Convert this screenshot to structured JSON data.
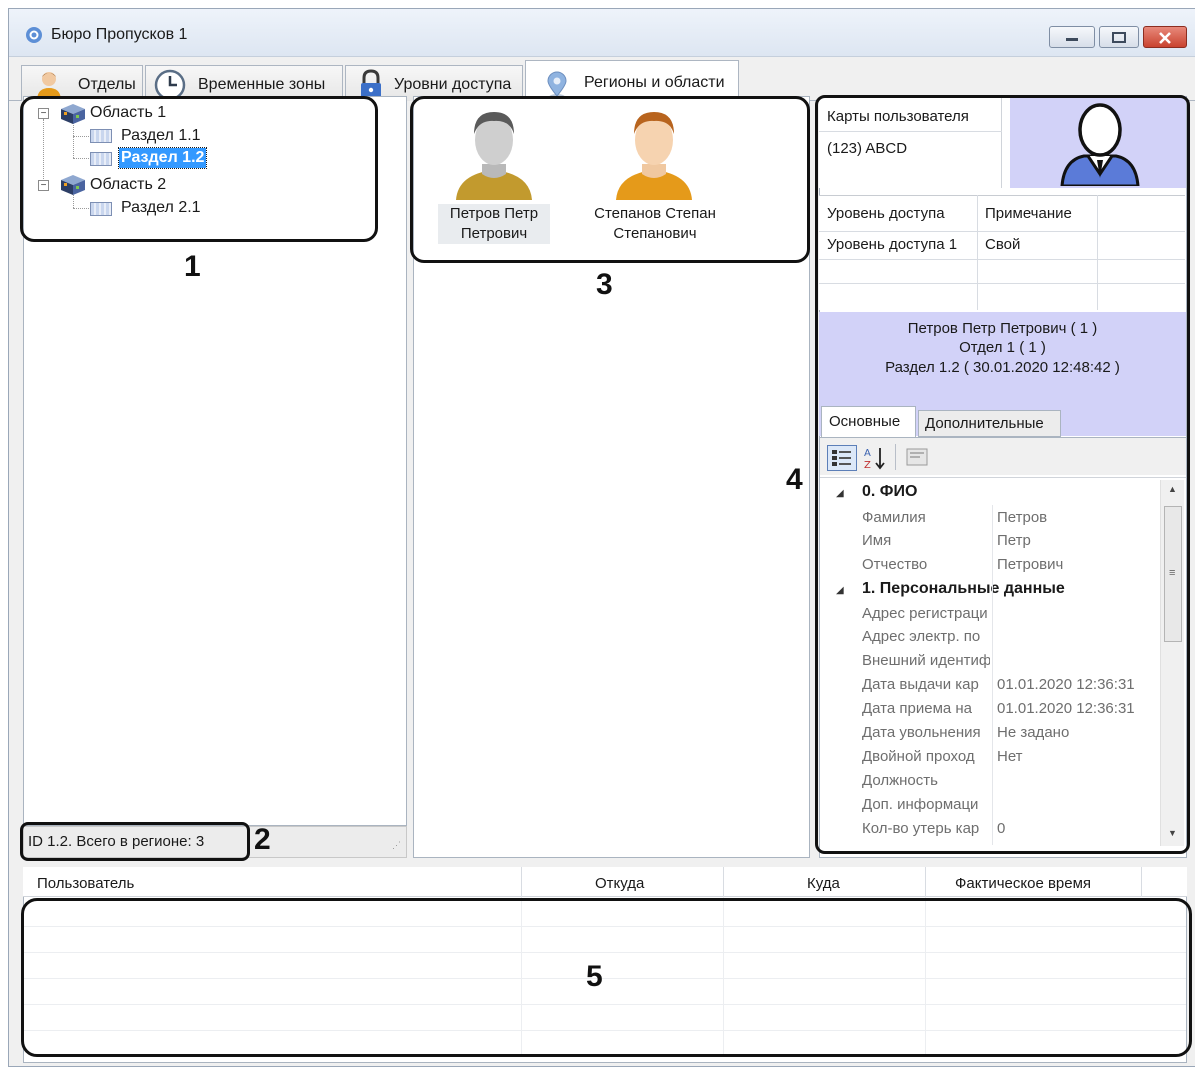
{
  "window": {
    "title": "Бюро Пропусков 1"
  },
  "tabs": [
    {
      "label": "Отделы",
      "icon": "person-icon"
    },
    {
      "label": "Временные зоны",
      "icon": "clock-icon"
    },
    {
      "label": "Уровни доступа",
      "icon": "padlock-icon"
    },
    {
      "label": "Регионы и области",
      "icon": "map-pin-icon",
      "active": true
    }
  ],
  "tree": {
    "items": [
      {
        "label": "Область 1",
        "type": "area"
      },
      {
        "label": "Раздел 1.1",
        "type": "section"
      },
      {
        "label": "Раздел 1.2",
        "type": "section",
        "selected": true
      },
      {
        "label": "Область 2",
        "type": "area"
      },
      {
        "label": "Раздел 2.1",
        "type": "section"
      }
    ]
  },
  "status": {
    "text": "ID 1.2. Всего в регионе: 3"
  },
  "users": [
    {
      "name": "Петров Петр Петрович",
      "line1": "Петров Петр",
      "line2": "Петрович",
      "selected": true
    },
    {
      "name": "Степанов Степан Степанович",
      "line1": "Степанов Степан",
      "line2": "Степанович"
    }
  ],
  "cards": {
    "header": "Карты пользователя",
    "items": [
      "(123) ABCD"
    ]
  },
  "access": {
    "headers": [
      "Уровень доступа",
      "Примечание"
    ],
    "rows": [
      {
        "level": "Уровень доступа 1",
        "note": "Свой"
      }
    ]
  },
  "selected_user": {
    "line1": "Петров Петр Петрович ( 1 )",
    "line2": "Отдел 1 ( 1 )",
    "line3": "Раздел 1.2 ( 30.01.2020 12:48:42 )"
  },
  "prop_tabs": [
    "Основные",
    "Дополнительные"
  ],
  "properties": {
    "cat0": "0. ФИО",
    "fio": [
      {
        "label": "Фамилия",
        "value": "Петров"
      },
      {
        "label": "Имя",
        "value": "Петр"
      },
      {
        "label": "Отчество",
        "value": "Петрович"
      }
    ],
    "cat1": "1. Персональные данные",
    "personal": [
      {
        "label": "Адрес регистраци",
        "value": ""
      },
      {
        "label": "Адрес электр. по",
        "value": ""
      },
      {
        "label": "Внешний идентиф",
        "value": ""
      },
      {
        "label": "Дата выдачи кар",
        "value": "01.01.2020 12:36:31"
      },
      {
        "label": "Дата приема на",
        "value": "01.01.2020 12:36:31"
      },
      {
        "label": "Дата увольнения",
        "value": "Не задано"
      },
      {
        "label": "Двойной проход",
        "value": "Нет"
      },
      {
        "label": "Должность",
        "value": ""
      },
      {
        "label": "Доп. информаци",
        "value": ""
      },
      {
        "label": "Кол-во утерь кар",
        "value": "0"
      }
    ]
  },
  "events": {
    "headers": [
      "Пользователь",
      "Откуда",
      "Куда",
      "Фактическое время"
    ]
  },
  "callouts": [
    "1",
    "2",
    "3",
    "4",
    "5"
  ],
  "colors": {
    "accent_panel": "#d2d2f8",
    "selection": "#3399ff"
  }
}
